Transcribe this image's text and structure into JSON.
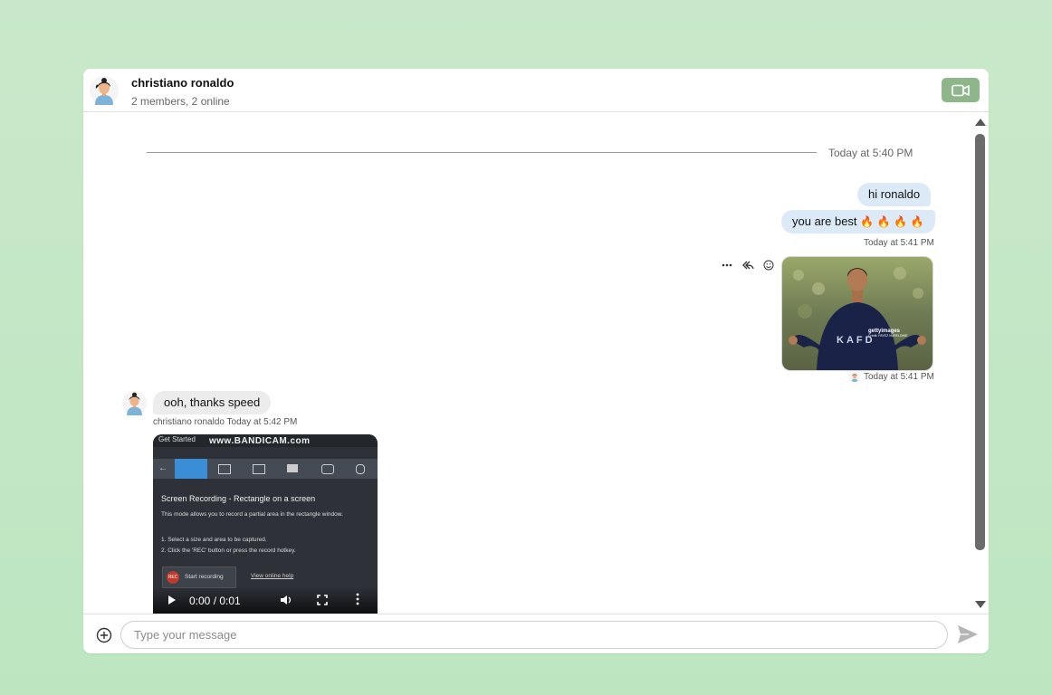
{
  "header": {
    "title": "christiano ronaldo",
    "subtitle": "2 members, 2 online",
    "video_icon": "video-camera-icon",
    "accent": "#8fb58a"
  },
  "messages": {
    "divider_label": "Today at 5:40 PM",
    "outgoing": [
      {
        "text": "hi ronaldo"
      },
      {
        "text": "you are best",
        "emoji": [
          "🔥",
          "🔥",
          "🔥",
          "🔥"
        ]
      }
    ],
    "outgoing_time": "Today at 5:41 PM",
    "photo_time": "Today at 5:41 PM",
    "photo_overlay": [
      "gettyimages",
      "Credit: FAYEZ NURELDINE"
    ],
    "photo_shirt_text": "KAFD",
    "actions": [
      "more-icon",
      "reply-all-icon",
      "emoji-icon"
    ],
    "incoming": {
      "text": "ooh, thanks speed",
      "sender": "christiano ronaldo",
      "time": "Today at 5:42 PM"
    },
    "video": {
      "tab_label": "Get Started",
      "brand": "www.BANDICAM.com",
      "heading": "Screen Recording - Rectangle on a screen",
      "description": "This mode allows you to record a partial area in the rectangle window.",
      "steps": [
        "1. Select a size and area to be captured.",
        "2. Click the 'REC' button or press the record hotkey."
      ],
      "rec_badge": "REC",
      "rec_label": "Start recording",
      "help_link": "View online help",
      "time": "0:00 / 0:01"
    }
  },
  "composer": {
    "placeholder": "Type your message",
    "bubble_out_color": "#dceaf8",
    "bubble_in_color": "#ececec"
  }
}
